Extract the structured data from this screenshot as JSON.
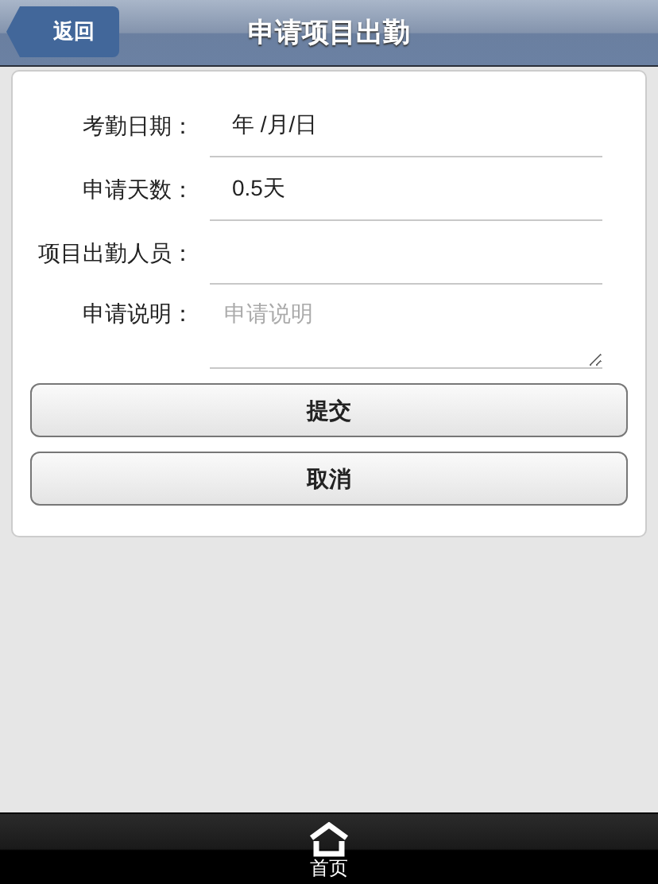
{
  "header": {
    "back_button": "返回",
    "title": "申请项目出勤"
  },
  "form": {
    "fields": [
      {
        "kind": "text",
        "label": "考勤日期：",
        "value": "年 /月/日"
      },
      {
        "kind": "text",
        "label": "申请天数：",
        "value": "0.5天"
      },
      {
        "kind": "text",
        "label": "项目出勤人员："
      },
      {
        "kind": "textarea",
        "label": "申请说明：",
        "placeholder": "申请说明"
      }
    ],
    "buttons": [
      "提交",
      "取消"
    ]
  },
  "footer": {
    "home": "首页"
  }
}
